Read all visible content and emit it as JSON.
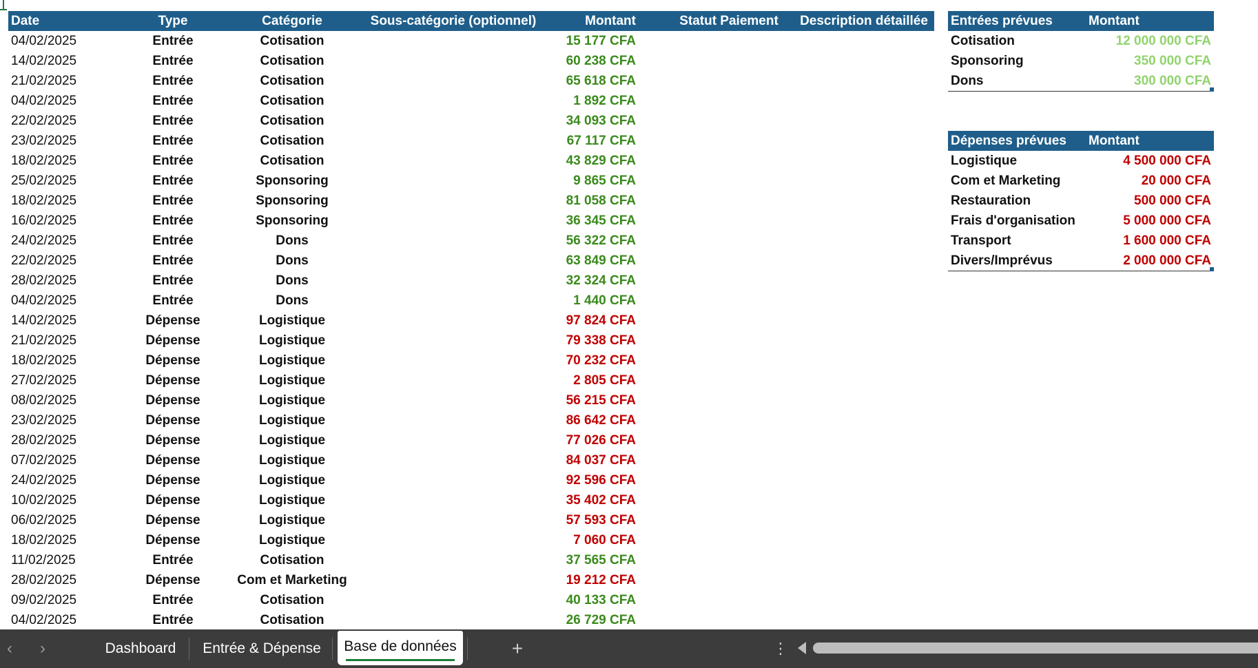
{
  "headers": {
    "date": "Date",
    "type": "Type",
    "category": "Catégorie",
    "subcategory": "Sous-catégorie (optionnel)",
    "amount": "Montant",
    "status": "Statut Paiement",
    "description": "Description détaillée"
  },
  "rows": [
    {
      "date": "04/02/2025",
      "type": "Entrée",
      "category": "Cotisation",
      "amount": "15 177 CFA",
      "kind": "in"
    },
    {
      "date": "14/02/2025",
      "type": "Entrée",
      "category": "Cotisation",
      "amount": "60 238 CFA",
      "kind": "in"
    },
    {
      "date": "21/02/2025",
      "type": "Entrée",
      "category": "Cotisation",
      "amount": "65 618 CFA",
      "kind": "in"
    },
    {
      "date": "04/02/2025",
      "type": "Entrée",
      "category": "Cotisation",
      "amount": "1 892 CFA",
      "kind": "in"
    },
    {
      "date": "22/02/2025",
      "type": "Entrée",
      "category": "Cotisation",
      "amount": "34 093 CFA",
      "kind": "in"
    },
    {
      "date": "23/02/2025",
      "type": "Entrée",
      "category": "Cotisation",
      "amount": "67 117 CFA",
      "kind": "in"
    },
    {
      "date": "18/02/2025",
      "type": "Entrée",
      "category": "Cotisation",
      "amount": "43 829 CFA",
      "kind": "in"
    },
    {
      "date": "25/02/2025",
      "type": "Entrée",
      "category": "Sponsoring",
      "amount": "9 865 CFA",
      "kind": "in"
    },
    {
      "date": "18/02/2025",
      "type": "Entrée",
      "category": "Sponsoring",
      "amount": "81 058 CFA",
      "kind": "in"
    },
    {
      "date": "16/02/2025",
      "type": "Entrée",
      "category": "Sponsoring",
      "amount": "36 345 CFA",
      "kind": "in"
    },
    {
      "date": "24/02/2025",
      "type": "Entrée",
      "category": "Dons",
      "amount": "56 322 CFA",
      "kind": "in"
    },
    {
      "date": "22/02/2025",
      "type": "Entrée",
      "category": "Dons",
      "amount": "63 849 CFA",
      "kind": "in"
    },
    {
      "date": "28/02/2025",
      "type": "Entrée",
      "category": "Dons",
      "amount": "32 324 CFA",
      "kind": "in"
    },
    {
      "date": "04/02/2025",
      "type": "Entrée",
      "category": "Dons",
      "amount": "1 440 CFA",
      "kind": "in"
    },
    {
      "date": "14/02/2025",
      "type": "Dépense",
      "category": "Logistique",
      "amount": "97 824 CFA",
      "kind": "out"
    },
    {
      "date": "21/02/2025",
      "type": "Dépense",
      "category": "Logistique",
      "amount": "79 338 CFA",
      "kind": "out"
    },
    {
      "date": "18/02/2025",
      "type": "Dépense",
      "category": "Logistique",
      "amount": "70 232 CFA",
      "kind": "out"
    },
    {
      "date": "27/02/2025",
      "type": "Dépense",
      "category": "Logistique",
      "amount": "2 805 CFA",
      "kind": "out"
    },
    {
      "date": "08/02/2025",
      "type": "Dépense",
      "category": "Logistique",
      "amount": "56 215 CFA",
      "kind": "out"
    },
    {
      "date": "23/02/2025",
      "type": "Dépense",
      "category": "Logistique",
      "amount": "86 642 CFA",
      "kind": "out"
    },
    {
      "date": "28/02/2025",
      "type": "Dépense",
      "category": "Logistique",
      "amount": "77 026 CFA",
      "kind": "out"
    },
    {
      "date": "07/02/2025",
      "type": "Dépense",
      "category": "Logistique",
      "amount": "84 037 CFA",
      "kind": "out"
    },
    {
      "date": "24/02/2025",
      "type": "Dépense",
      "category": "Logistique",
      "amount": "92 596 CFA",
      "kind": "out"
    },
    {
      "date": "10/02/2025",
      "type": "Dépense",
      "category": "Logistique",
      "amount": "35 402 CFA",
      "kind": "out"
    },
    {
      "date": "06/02/2025",
      "type": "Dépense",
      "category": "Logistique",
      "amount": "57 593 CFA",
      "kind": "out"
    },
    {
      "date": "18/02/2025",
      "type": "Dépense",
      "category": "Logistique",
      "amount": "7 060 CFA",
      "kind": "out"
    },
    {
      "date": "11/02/2025",
      "type": "Entrée",
      "category": "Cotisation",
      "amount": "37 565 CFA",
      "kind": "in"
    },
    {
      "date": "28/02/2025",
      "type": "Dépense",
      "category": "Com et Marketing",
      "amount": "19 212 CFA",
      "kind": "out"
    },
    {
      "date": "09/02/2025",
      "type": "Entrée",
      "category": "Cotisation",
      "amount": "40 133 CFA",
      "kind": "in"
    },
    {
      "date": "04/02/2025",
      "type": "Entrée",
      "category": "Cotisation",
      "amount": "26 729 CFA",
      "kind": "in"
    }
  ],
  "planned_income": {
    "header_label": "Entrées prévues",
    "header_amount": "Montant",
    "items": [
      {
        "label": "Cotisation",
        "amount": "12 000 000 CFA"
      },
      {
        "label": "Sponsoring",
        "amount": "350 000 CFA"
      },
      {
        "label": "Dons",
        "amount": "300 000 CFA"
      }
    ]
  },
  "planned_expenses": {
    "header_label": "Dépenses prévues",
    "header_amount": "Montant",
    "items": [
      {
        "label": "Logistique",
        "amount": "4 500 000 CFA"
      },
      {
        "label": "Com et Marketing",
        "amount": "20 000 CFA"
      },
      {
        "label": "Restauration",
        "amount": "500 000 CFA"
      },
      {
        "label": "Frais d'organisation",
        "amount": "5 000 000 CFA"
      },
      {
        "label": "Transport",
        "amount": "1 600 000 CFA"
      },
      {
        "label": "Divers/Imprévus",
        "amount": "2 000 000 CFA"
      }
    ]
  },
  "tabs": [
    {
      "label": "Dashboard",
      "active": false
    },
    {
      "label": "Entrée & Dépense",
      "active": false
    },
    {
      "label": "Base de données",
      "active": true
    }
  ],
  "tabbar": {
    "prev_icon": "‹",
    "next_icon": "›",
    "add_icon": "+",
    "more_icon": "⋮"
  },
  "colors": {
    "header_bg": "#1f5e8a",
    "income_green": "#3a8a1c",
    "expense_red": "#c00000",
    "planned_income_green": "#92d36e",
    "active_tab_underline": "#1a7c3a"
  },
  "icons": [
    "chevron-left-icon",
    "chevron-right-icon",
    "plus-icon",
    "more-vertical-icon",
    "scroll-left-icon"
  ]
}
